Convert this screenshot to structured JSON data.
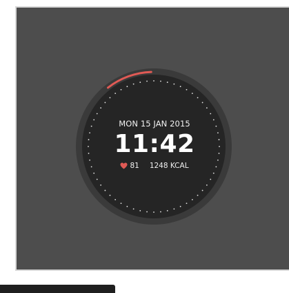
{
  "watch": {
    "date": "MON 15 JAN 2015",
    "time": "11:42",
    "heart_rate": "81",
    "calories": "1248 KCAL"
  },
  "colors": {
    "panel": "#4d4d4d",
    "bezel": "#3a3a3a",
    "face": "#252525",
    "progress_arc": "#e05a55",
    "heart": "#e05a55",
    "text": "#ffffff"
  },
  "icons": {
    "heart": "heart-icon"
  }
}
